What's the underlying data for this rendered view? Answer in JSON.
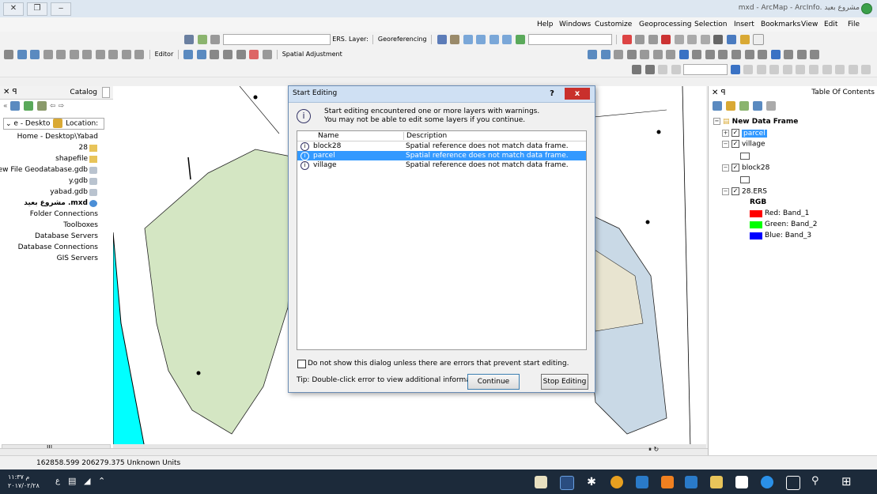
{
  "titlebar": {
    "title": "mxd - ArcMap - ArcInfo. مشروع بعيد"
  },
  "menu": {
    "items": [
      "Help",
      "Windows",
      "Customize",
      "Geoprocessing",
      "Selection",
      "Insert",
      "Bookmarks",
      "View",
      "Edit",
      "File"
    ]
  },
  "toolbar": {
    "layer_label": "Layer:",
    "layer_value": "ERS.",
    "georef_label": "Georeferencing",
    "editor_label": "Editor",
    "spatial_adj_label": "Spatial Adjustment"
  },
  "catalog": {
    "title": "Catalog",
    "location_label": "Location:",
    "location_value": "e - Deskto",
    "items": [
      {
        "label": "Home - Desktop\\Yabad",
        "icon": "none"
      },
      {
        "label": "28",
        "icon": "folder-icon"
      },
      {
        "label": "shapefile",
        "icon": "folder-icon"
      },
      {
        "label": "New File Geodatabase.gdb",
        "icon": "geodatabase-icon"
      },
      {
        "label": "y.gdb",
        "icon": "geodatabase-icon"
      },
      {
        "label": "yabad.gdb",
        "icon": "geodatabase-icon"
      },
      {
        "label": "مشروع بعيد .mxd",
        "icon": "map-document-icon"
      },
      {
        "label": "Folder Connections",
        "icon": "none"
      },
      {
        "label": "Toolboxes",
        "icon": "none"
      },
      {
        "label": "Database Servers",
        "icon": "none"
      },
      {
        "label": "Database Connections",
        "icon": "none"
      },
      {
        "label": "GIS Servers",
        "icon": "none"
      }
    ]
  },
  "toc": {
    "title": "Table Of Contents",
    "frame": "New Data Frame",
    "layers": [
      {
        "name": "parcel",
        "checked": true,
        "selected": true
      },
      {
        "name": "village",
        "checked": true,
        "selected": false
      },
      {
        "name": "block28",
        "checked": true,
        "selected": false
      },
      {
        "name": "28.ERS",
        "checked": true,
        "selected": false
      }
    ],
    "raster_label": "RGB",
    "bands": [
      {
        "label": "Red:  Band_1",
        "color": "#ff0000"
      },
      {
        "label": "Green: Band_2",
        "color": "#00ff00"
      },
      {
        "label": "Blue:  Band_3",
        "color": "#0000ff"
      }
    ]
  },
  "dialog": {
    "title": "Start Editing",
    "help": "?",
    "close": "x",
    "message_line1": "Start editing encountered one or more layers with warnings.",
    "message_line2": "You may not be able to edit some layers if you continue.",
    "col_name": "Name",
    "col_description": "Description",
    "rows": [
      {
        "name": "block28",
        "description": "Spatial reference does not match data frame.",
        "selected": false
      },
      {
        "name": "parcel",
        "description": "Spatial reference does not match data frame.",
        "selected": true
      },
      {
        "name": "village",
        "description": "Spatial reference does not match data frame.",
        "selected": false
      }
    ],
    "checkbox_label": "Do not show this dialog unless there are errors that prevent start editing.",
    "tip": "Tip: Double-click error to view additional information",
    "continue": "Continue",
    "stop": "Stop Editing"
  },
  "statusbar": {
    "coords": "162858.599  206279.375 Unknown Units"
  },
  "taskbar": {
    "time": "م ١١:٣٧",
    "date": "٢٠١٧/٠٢/٢٨",
    "lang": "ع"
  },
  "colors": {
    "sea": "#00ffff",
    "landuse": "#d4e6c3",
    "parcels": "#c9c9e6",
    "selected": "#3399ff"
  }
}
